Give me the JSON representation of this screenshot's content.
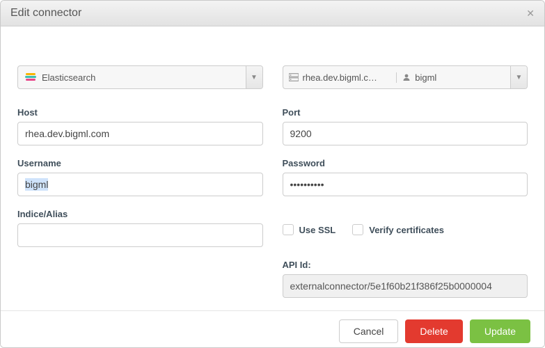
{
  "header": {
    "title": "Edit connector"
  },
  "selectors": {
    "engine_label": "Elasticsearch",
    "host_display": "rhea.dev.bigml.c…",
    "user_display": "bigml"
  },
  "fields": {
    "host": {
      "label": "Host",
      "value": "rhea.dev.bigml.com"
    },
    "port": {
      "label": "Port",
      "value": "9200"
    },
    "username": {
      "label": "Username",
      "value": "bigml"
    },
    "password": {
      "label": "Password",
      "value": "••••••••••"
    },
    "indice": {
      "label": "Indice/Alias",
      "value": ""
    },
    "use_ssl": {
      "label": "Use SSL",
      "checked": false
    },
    "verify": {
      "label": "Verify certificates",
      "checked": false
    },
    "api_id": {
      "label": "API Id:",
      "value": "externalconnector/5e1f60b21f386f25b0000004"
    }
  },
  "buttons": {
    "cancel": "Cancel",
    "delete": "Delete",
    "update": "Update"
  }
}
